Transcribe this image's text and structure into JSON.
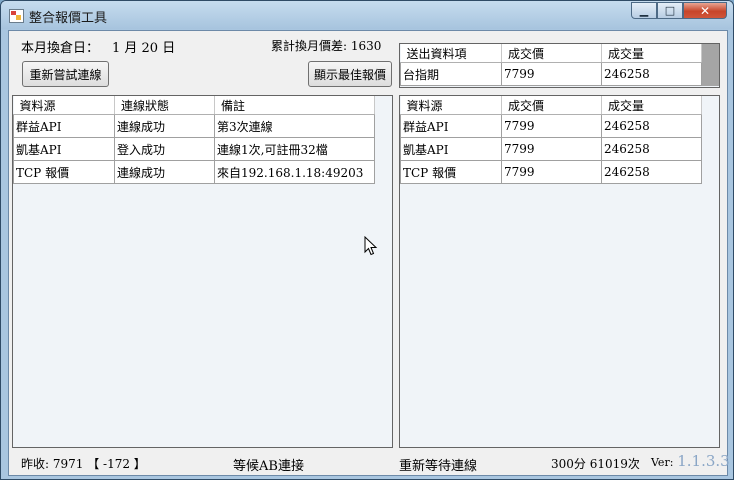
{
  "window": {
    "title": "整合報價工具",
    "minimize_glyph": "▁",
    "maximize_glyph": "□",
    "close_glyph": "✕"
  },
  "top": {
    "rollover_label": "本月換倉日：",
    "rollover_value": "1 月 20 日",
    "cumulative_label": "累計換月價差: 1630",
    "retry_button": "重新嘗試連線",
    "best_quote_button": "顯示最佳報價"
  },
  "output_grid": {
    "headers": [
      "送出資料項",
      "成交價",
      "成交量"
    ],
    "rows": [
      [
        "台指期",
        "7799",
        "246258"
      ]
    ]
  },
  "connection_grid": {
    "headers": [
      "資料源",
      "連線狀態",
      "備註"
    ],
    "rows": [
      [
        "群益API",
        "連線成功",
        "第3次連線"
      ],
      [
        "凱基API",
        "登入成功",
        "連線1次,可註冊32檔"
      ],
      [
        "TCP 報價",
        "連線成功",
        "來自192.168.1.18:49203"
      ]
    ]
  },
  "price_grid": {
    "headers": [
      "資料源",
      "成交價",
      "成交量"
    ],
    "rows": [
      [
        "群益API",
        "7799",
        "246258"
      ],
      [
        "凱基API",
        "7799",
        "246258"
      ],
      [
        "TCP 報價",
        "7799",
        "246258"
      ]
    ]
  },
  "status": {
    "yesterday_close": "昨收: 7971 【 -172 】",
    "waiting_ab": "等候AB連接",
    "reconnect_wait": "重新等待連線",
    "counter": "300分 61019次",
    "ver_label": "Ver:",
    "ver_value": "1.1.3.3"
  }
}
